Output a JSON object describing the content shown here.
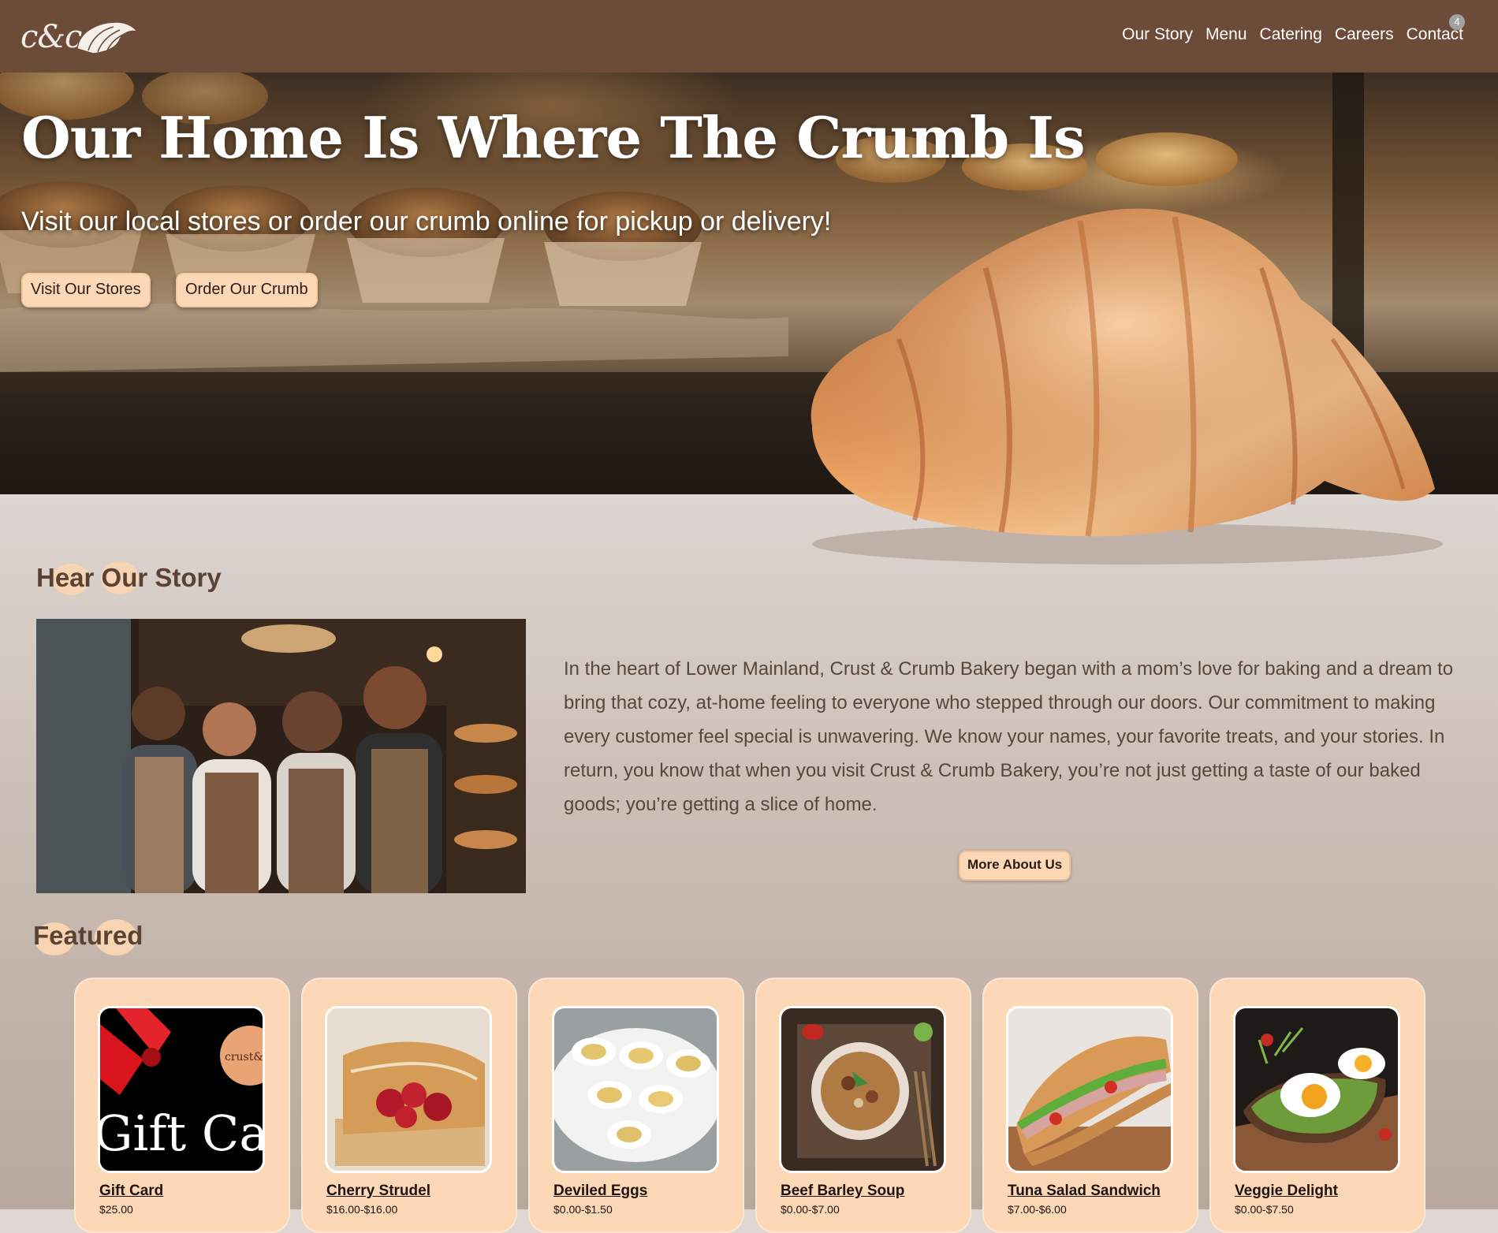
{
  "header": {
    "logo_text": "c&c",
    "nav": [
      "Our Story",
      "Menu",
      "Catering",
      "Careers",
      "Contact"
    ],
    "contact_badge": "4"
  },
  "hero": {
    "title": "Our Home Is Where The Crumb Is",
    "subtitle": "Visit our local stores or order our crumb online for pickup or delivery!",
    "buttons": [
      "Visit Our Stores",
      "Order Our Crumb"
    ]
  },
  "story": {
    "title": "Hear Our Story",
    "text": "In the heart of Lower Mainland, Crust & Crumb Bakery began with a mom’s love for baking and a dream to bring that cozy, at-home feeling to everyone who stepped through our doors. Our commitment to making every customer feel special is unwavering. We know your names, your favorite treats, and your stories. In return, you know that when you visit Crust & Crumb Bakery, you’re not just getting a taste of our baked goods; you’re getting a slice of home.",
    "button": "More About Us"
  },
  "featured": {
    "title": "Featured",
    "gift_card_label": "Gift Car",
    "gift_card_brand": "crust&",
    "items": [
      {
        "name": "Gift Card",
        "price": "$25.00"
      },
      {
        "name": "Cherry Strudel",
        "price": "$16.00-$16.00"
      },
      {
        "name": "Deviled Eggs",
        "price": "$0.00-$1.50"
      },
      {
        "name": "Beef Barley Soup",
        "price": "$0.00-$7.00"
      },
      {
        "name": "Tuna Salad Sandwich",
        "price": "$7.00-$6.00"
      },
      {
        "name": "Veggie Delight",
        "price": "$0.00-$7.50"
      }
    ]
  },
  "colors": {
    "header_bg": "#6c4c38",
    "accent": "#fcd8b6",
    "page_bg": "#ddd6d2"
  }
}
